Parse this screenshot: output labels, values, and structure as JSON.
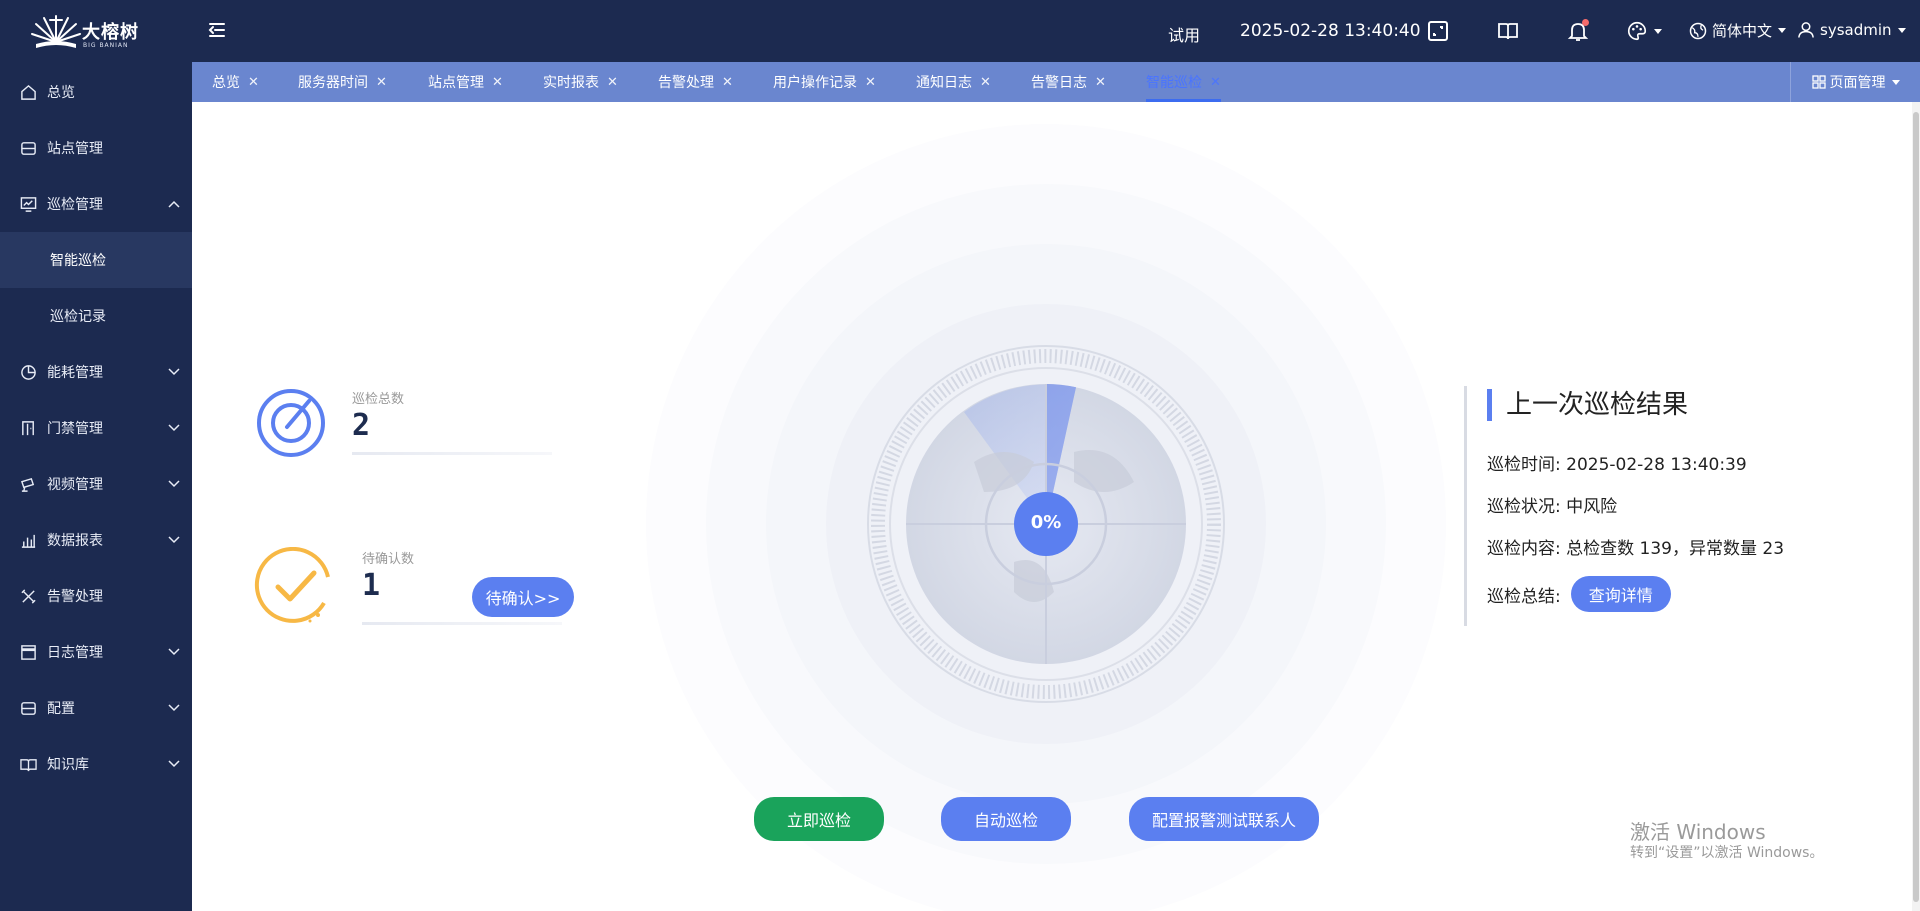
{
  "brand": {
    "name": "大榕树",
    "sub": "BIG BANIAN"
  },
  "header": {
    "trial": "试用",
    "datetime": "2025-02-28 13:40:40",
    "language": "简体中文",
    "user": "sysadmin"
  },
  "sidebar": {
    "items": [
      {
        "label": "总览",
        "icon": "home-icon"
      },
      {
        "label": "站点管理",
        "icon": "server-icon"
      },
      {
        "label": "巡检管理",
        "icon": "monitor-icon",
        "expanded": true
      },
      {
        "label": "能耗管理",
        "icon": "pie-chart-icon"
      },
      {
        "label": "门禁管理",
        "icon": "door-icon"
      },
      {
        "label": "视频管理",
        "icon": "camera-icon"
      },
      {
        "label": "数据报表",
        "icon": "bar-chart-icon"
      },
      {
        "label": "告警处理",
        "icon": "tools-icon"
      },
      {
        "label": "日志管理",
        "icon": "log-icon"
      },
      {
        "label": "配置",
        "icon": "config-icon"
      },
      {
        "label": "知识库",
        "icon": "book-icon"
      }
    ],
    "subitems": [
      {
        "label": "智能巡检",
        "active": true
      },
      {
        "label": "巡检记录"
      }
    ]
  },
  "tabs": [
    {
      "label": "总览"
    },
    {
      "label": "服务器时间"
    },
    {
      "label": "站点管理"
    },
    {
      "label": "实时报表"
    },
    {
      "label": "告警处理"
    },
    {
      "label": "用户操作记录"
    },
    {
      "label": "通知日志"
    },
    {
      "label": "告警日志"
    },
    {
      "label": "智能巡检",
      "active": true
    }
  ],
  "page_manager": "页面管理",
  "stats": {
    "total": {
      "label": "巡检总数",
      "value": "2"
    },
    "pending": {
      "label": "待确认数",
      "value": "1",
      "button": "待确认>>"
    }
  },
  "radar": {
    "progress_text": "0%",
    "progress": 0
  },
  "actions": {
    "start": "立即巡检",
    "auto": "自动巡检",
    "config": "配置报警测试联系人"
  },
  "result": {
    "title": "上一次巡检结果",
    "time_label": "巡检时间:",
    "time": "2025-02-28 13:40:39",
    "status_label": "巡检状况:",
    "status": "中风险",
    "content_label": "巡检内容:",
    "content": "总检查数 139，异常数量 23",
    "summary_label": "巡检总结:",
    "detail_button": "查询详情"
  },
  "watermark": {
    "line1": "激活 Windows",
    "line2": "转到“设置”以激活 Windows。"
  },
  "colors": {
    "sidebar_bg": "#1c2a50",
    "tabbar_bg": "#6a86cf",
    "accent": "#5b7ff0",
    "green": "#1aa35b",
    "pending_orange": "#f7b845"
  }
}
